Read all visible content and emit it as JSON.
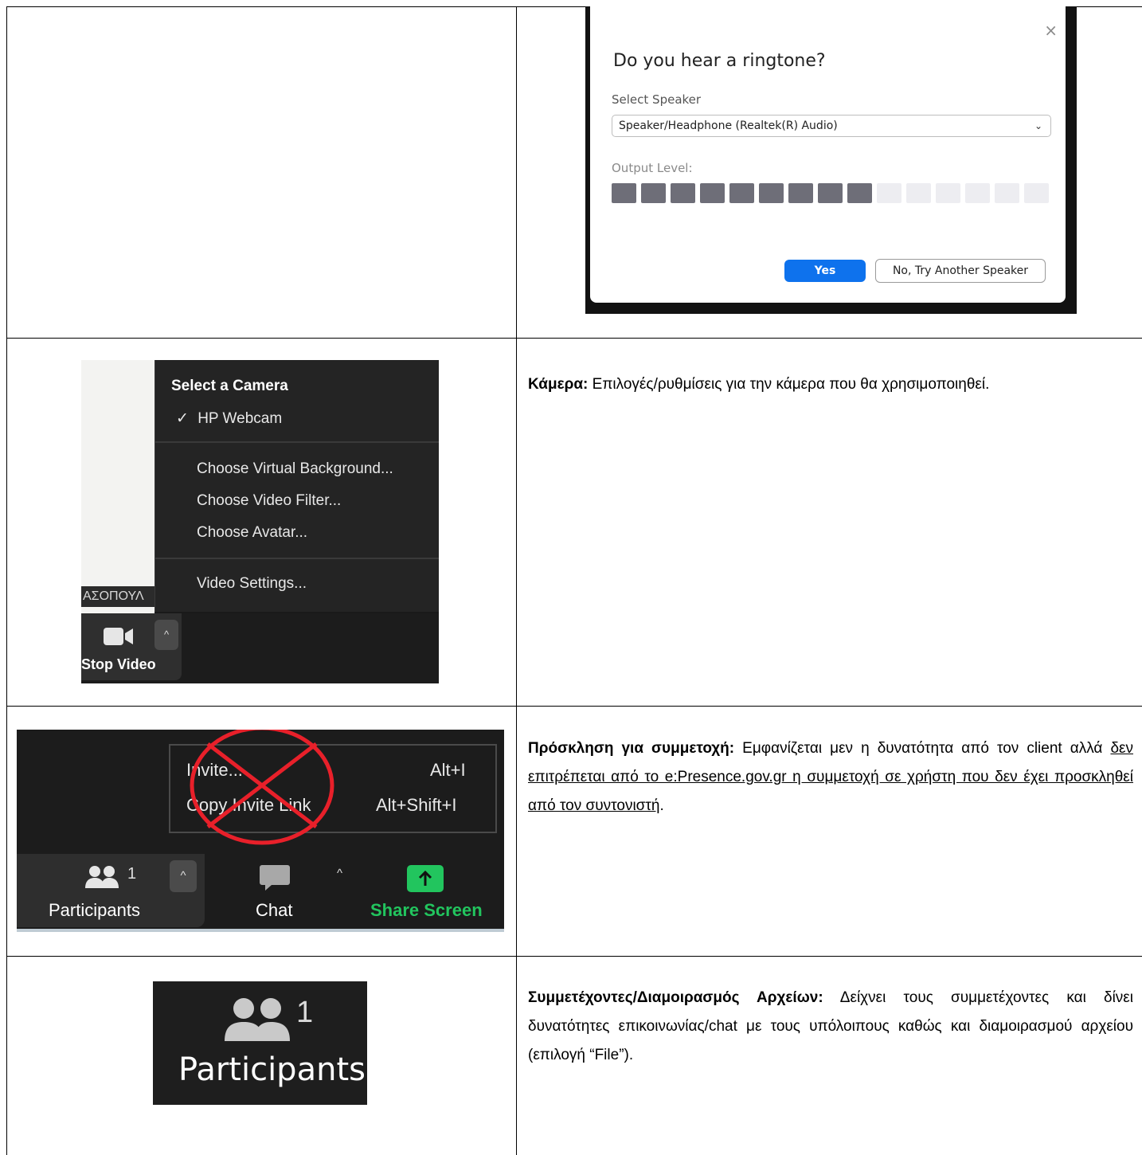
{
  "ringtone_dialog": {
    "close_symbol": "×",
    "title": "Do you hear a ringtone?",
    "speaker_label": "Select Speaker",
    "speaker_value": "Speaker/Headphone (Realtek(R) Audio)",
    "output_label": "Output Level:",
    "output_level": {
      "active_segments": 9,
      "total_segments": 15
    },
    "yes_button": "Yes",
    "no_button": "No, Try Another Speaker",
    "colors": {
      "primary": "#0e72ed",
      "level_on": "#6e6e78",
      "level_off": "#ededf1"
    }
  },
  "camera_panel": {
    "name_tag": "ΑΣΟΠΟΥΛ",
    "menu_header": "Select a Camera",
    "check_mark": "✓",
    "camera_option": "HP Webcam",
    "menu_items": [
      "Choose Virtual Background...",
      "Choose Video Filter...",
      "Choose Avatar..."
    ],
    "settings_item": "Video Settings...",
    "stop_video_label": "Stop Video",
    "caret": "^",
    "description_title": "Κάμερα:",
    "description_text": " Επιλογές/ρυθμίσεις για την κάμερα που θα χρησιμοποιηθεί."
  },
  "invite_panel": {
    "menu_items": [
      {
        "label": "Invite...",
        "shortcut": "Alt+I"
      },
      {
        "label": "Copy Invite Link",
        "shortcut": "Alt+Shift+I"
      }
    ],
    "toolbar": {
      "participants_count": "1",
      "participants_label": "Participants",
      "chat_label": "Chat",
      "share_label": "Share Screen",
      "caret": "^"
    },
    "colors": {
      "cross": "#e8202a",
      "share": "#22c55e"
    },
    "description_title": "Πρόσκληση για συμμετοχή:",
    "description_text1": " Εμφανίζεται μεν η δυνατότητα από τον client αλλά ",
    "description_underlined": "δεν επιτρέπεται από το e:Presence.gov.gr η συμμετοχή σε χρήστη που δεν έχει προσκληθεί από τον συντονιστή",
    "description_end": "."
  },
  "participants_panel": {
    "count": "1",
    "label": "Participants",
    "description_title": "Συμμετέχοντες/Διαμοιρασμός Αρχείων:",
    "description_text": " Δείχνει τους συμμετέχοντες και δίνει δυνατότητες επικοινωνίας/chat με τους υπόλοιπους καθώς και διαμοιρασμού αρχείου (επιλογή “File”)."
  }
}
